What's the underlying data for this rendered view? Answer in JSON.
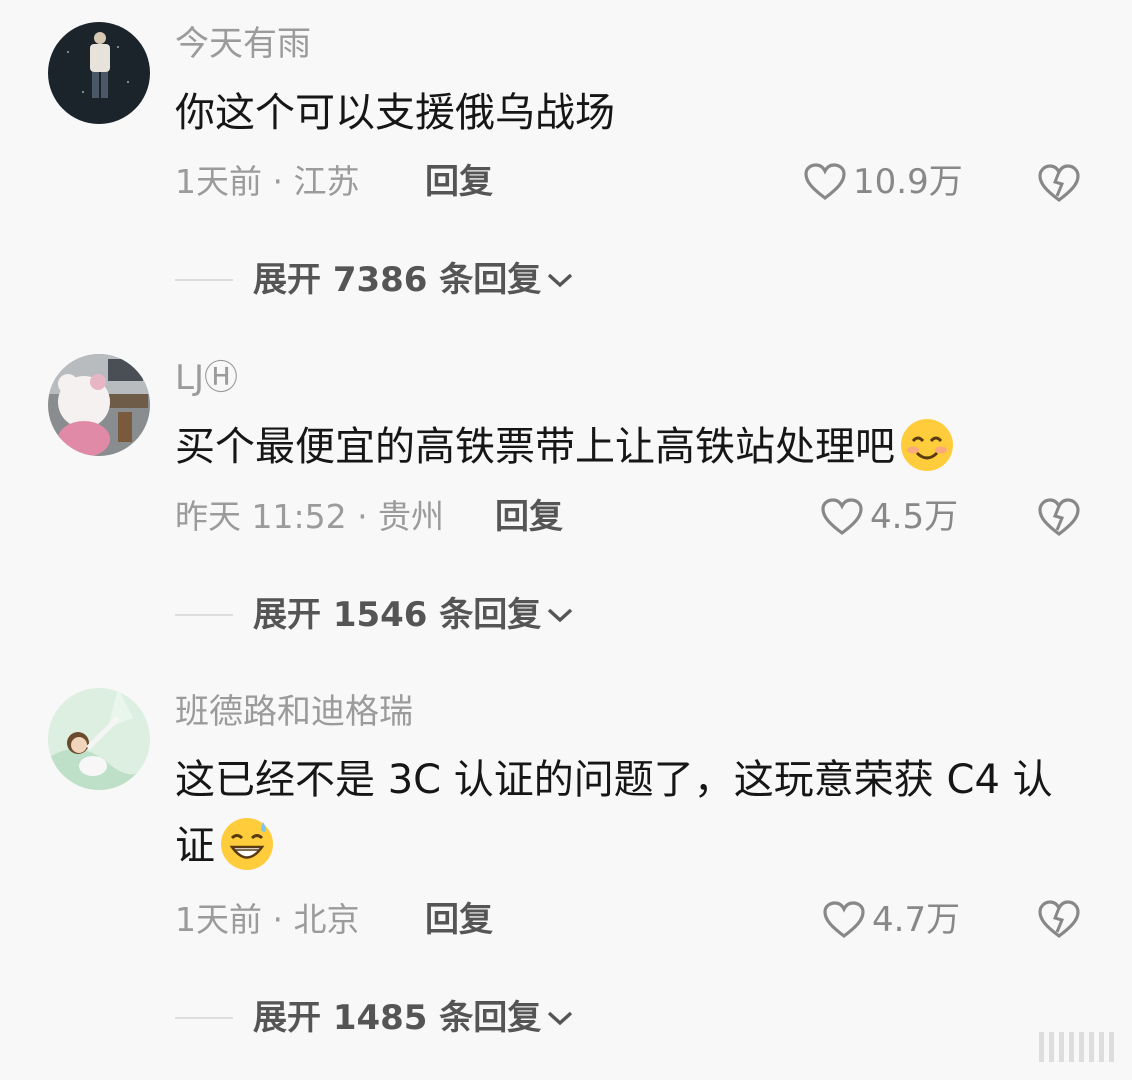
{
  "comments": [
    {
      "username": "今天有雨",
      "text": "你这个可以支援俄乌战场",
      "meta": "1天前 · 江苏",
      "reply_label": "回复",
      "likes": "10.9万",
      "expand_label": "展开 7386 条回复"
    },
    {
      "username": "LJⒽ",
      "text": "买个最便宜的高铁票带上让高铁站处理吧",
      "emoji": "smile",
      "meta": "昨天 11:52 · 贵州",
      "reply_label": "回复",
      "likes": "4.5万",
      "expand_label": "展开 1546 条回复"
    },
    {
      "username": "班德路和迪格瑞",
      "text": "这已经不是 3C 认证的问题了，这玩意荣获 C4 认证",
      "emoji": "grin-sweat",
      "meta": "1天前 · 北京",
      "reply_label": "回复",
      "likes": "4.7万",
      "expand_label": "展开 1485 条回复"
    }
  ],
  "colors": {
    "background": "#f8f8f8",
    "text": "#161616",
    "muted": "#9b9b9b",
    "action": "#555555"
  },
  "icons": [
    "heart-icon",
    "broken-heart-icon",
    "chevron-down-icon"
  ]
}
